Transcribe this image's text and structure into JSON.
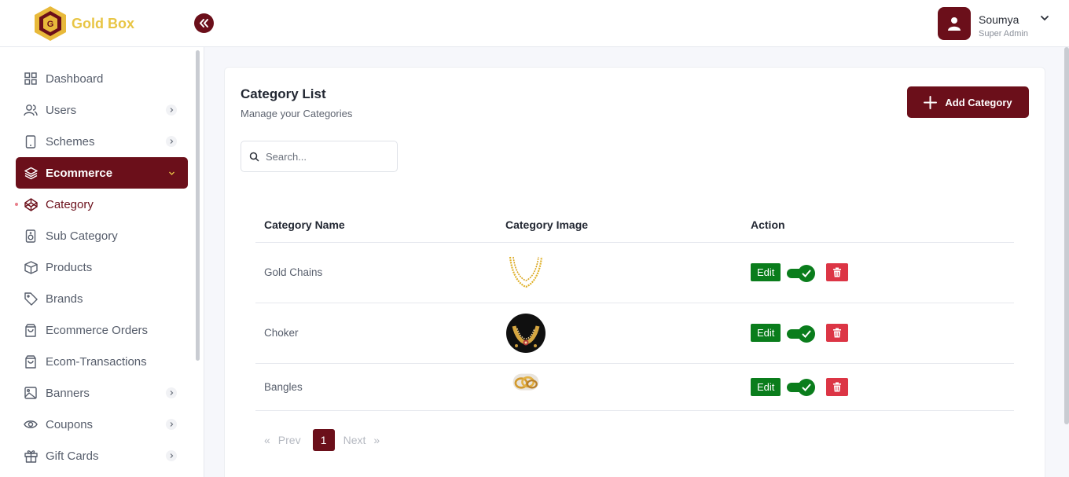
{
  "app": {
    "brand": "Gold Box"
  },
  "user": {
    "name": "Soumya",
    "role": "Super Admin"
  },
  "sidebar": {
    "items": [
      {
        "label": "Dashboard"
      },
      {
        "label": "Users"
      },
      {
        "label": "Schemes"
      },
      {
        "label": "Ecommerce"
      },
      {
        "label": "Category"
      },
      {
        "label": "Sub Category"
      },
      {
        "label": "Products"
      },
      {
        "label": "Brands"
      },
      {
        "label": "Ecommerce Orders"
      },
      {
        "label": "Ecom-Transactions"
      },
      {
        "label": "Banners"
      },
      {
        "label": "Coupons"
      },
      {
        "label": "Gift Cards"
      }
    ]
  },
  "main": {
    "title": "Category List",
    "subtitle": "Manage your Categories",
    "add_label": "Add Category",
    "search_placeholder": "Search...",
    "columns": [
      "Category Name",
      "Category Image",
      "Action"
    ],
    "rows": [
      {
        "name": "Gold Chains",
        "image": "gold-chain-image",
        "edit": "Edit",
        "status": "active"
      },
      {
        "name": "Choker",
        "image": "choker-image",
        "edit": "Edit",
        "status": "active"
      },
      {
        "name": "Bangles",
        "image": "bangles-image",
        "edit": "Edit",
        "status": "active"
      }
    ],
    "pagination": {
      "prev": "Prev",
      "next": "Next",
      "current": "1",
      "prev_arrow": "«",
      "next_arrow": "»"
    }
  },
  "colors": {
    "primary": "#6b0f1a",
    "gold": "#e8c545",
    "success": "#0a7d1c",
    "danger": "#dc3545"
  }
}
